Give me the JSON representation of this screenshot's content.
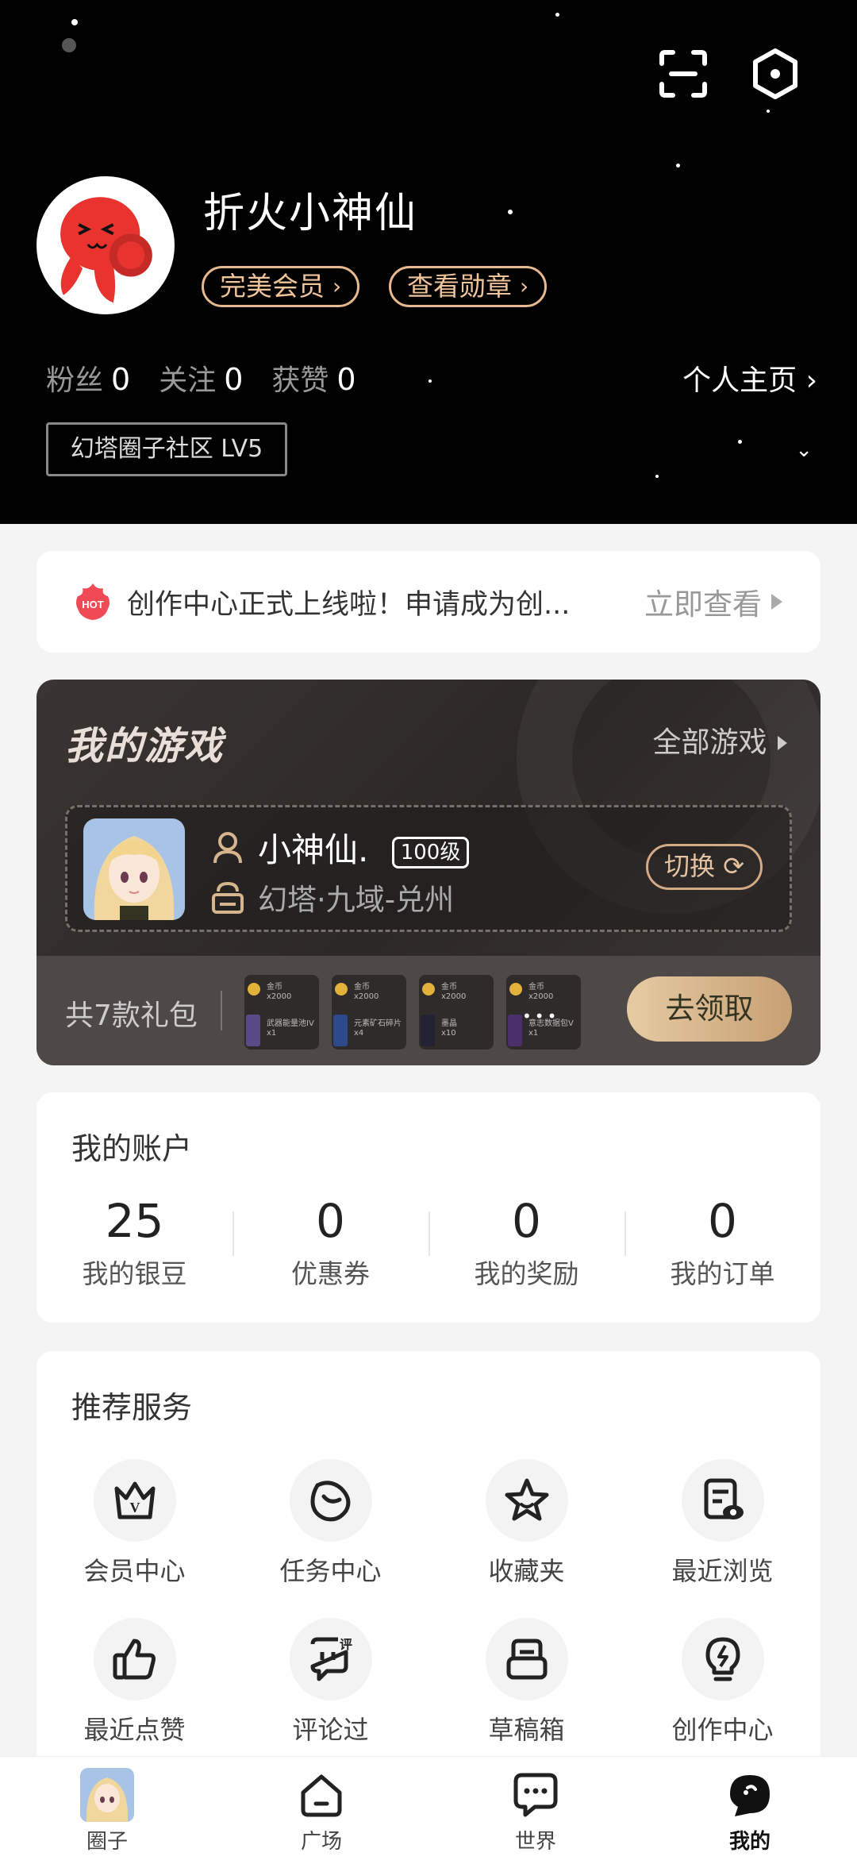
{
  "profile": {
    "username": "折火小神仙",
    "vip_pill": "完美会员",
    "medal_pill": "查看勋章",
    "followers_label": "粉丝",
    "followers_value": "0",
    "following_label": "关注",
    "following_value": "0",
    "likes_label": "获赞",
    "likes_value": "0",
    "homepage_label": "个人主页",
    "community_level": "幻塔圈子社区 LV5"
  },
  "notice": {
    "icon": "hot-icon",
    "text": "创作中心正式上线啦！申请成为创...",
    "link": "立即查看"
  },
  "games": {
    "title": "我的游戏",
    "all_label": "全部游戏",
    "character_name": "小神仙.",
    "character_level": "100级",
    "server": "幻塔·九域-兑州",
    "switch_label": "切换",
    "gift_count_label": "共7款礼包",
    "gifts": [
      {
        "line1": "金币",
        "line2": "x2000",
        "line3": "武器能量池IV",
        "line4": "x1"
      },
      {
        "line1": "金币",
        "line2": "x2000",
        "line3": "元素矿石碎片",
        "line4": "x4"
      },
      {
        "line1": "金币",
        "line2": "x2000",
        "line3": "墨晶",
        "line4": "x10"
      },
      {
        "line1": "金币",
        "line2": "x2000",
        "line3": "意志数据包V",
        "line4": "x1"
      }
    ],
    "claim_label": "去领取"
  },
  "account": {
    "title": "我的账户",
    "items": [
      {
        "value": "25",
        "label": "我的银豆"
      },
      {
        "value": "0",
        "label": "优惠券"
      },
      {
        "value": "0",
        "label": "我的奖励"
      },
      {
        "value": "0",
        "label": "我的订单"
      }
    ]
  },
  "services": {
    "title": "推荐服务",
    "items": [
      {
        "label": "会员中心",
        "icon": "vip-crown-icon"
      },
      {
        "label": "任务中心",
        "icon": "task-icon"
      },
      {
        "label": "收藏夹",
        "icon": "star-icon"
      },
      {
        "label": "最近浏览",
        "icon": "history-icon"
      },
      {
        "label": "最近点赞",
        "icon": "thumbs-up-icon"
      },
      {
        "label": "评论过",
        "icon": "comment-icon"
      },
      {
        "label": "草稿箱",
        "icon": "drafts-icon"
      },
      {
        "label": "创作中心",
        "icon": "lightbulb-icon"
      }
    ]
  },
  "tabs": [
    {
      "label": "圈子",
      "icon": "circle-avatar-icon"
    },
    {
      "label": "广场",
      "icon": "home-icon"
    },
    {
      "label": "世界",
      "icon": "chat-icon"
    },
    {
      "label": "我的",
      "icon": "me-icon"
    }
  ],
  "colors": {
    "accent_gold": "#e7b98e",
    "header_bg": "#000000",
    "card_bg": "#ffffff",
    "page_bg": "#f4f4f4"
  }
}
